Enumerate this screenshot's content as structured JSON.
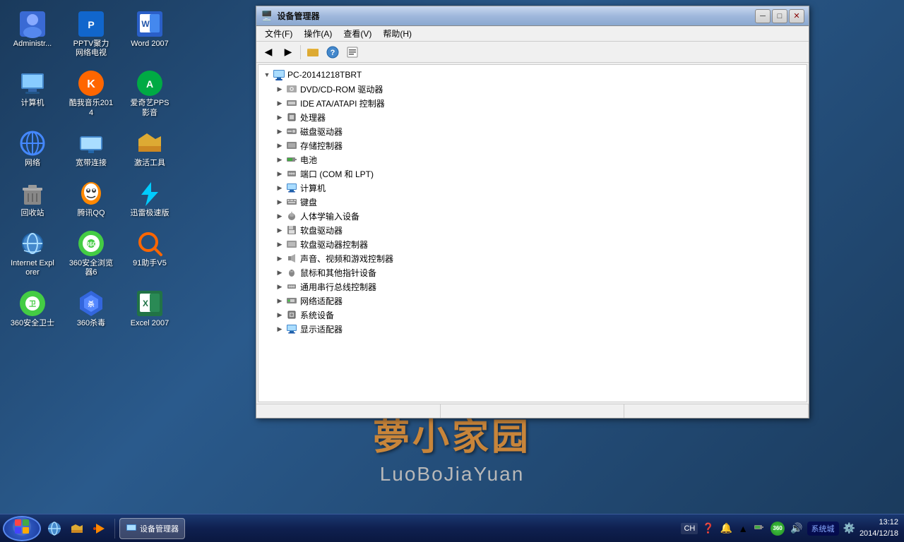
{
  "desktop": {
    "background": "#1a3a5c",
    "watermark": {
      "chinese": "夢小家园",
      "english": "LuoBoJiaYuan"
    },
    "icons": [
      {
        "id": "admin",
        "label": "Administr...",
        "icon": "👤",
        "color": "icon-blue"
      },
      {
        "id": "pptv",
        "label": "PPTV聚力 网络电视",
        "icon": "📺",
        "color": "icon-blue"
      },
      {
        "id": "word2007",
        "label": "Word 2007",
        "icon": "📝",
        "color": "icon-blue"
      },
      {
        "id": "computer",
        "label": "计算机",
        "icon": "🖥️",
        "color": "icon-blue"
      },
      {
        "id": "kuwo",
        "label": "酷我音乐2014",
        "icon": "🎵",
        "color": "icon-orange"
      },
      {
        "id": "aiqiyi",
        "label": "爱奇艺PPS影音",
        "icon": "🎬",
        "color": "icon-orange"
      },
      {
        "id": "network",
        "label": "网络",
        "icon": "🌐",
        "color": "icon-blue"
      },
      {
        "id": "broadband",
        "label": "宽带连接",
        "icon": "💻",
        "color": "icon-blue"
      },
      {
        "id": "activation",
        "label": "激活工具",
        "icon": "📂",
        "color": "icon-yellow"
      },
      {
        "id": "recycle",
        "label": "回收站",
        "icon": "🗑️",
        "color": "icon-gray"
      },
      {
        "id": "qq",
        "label": "腾讯QQ",
        "icon": "🐧",
        "color": "icon-orange"
      },
      {
        "id": "thunder",
        "label": "迅雷极速版",
        "icon": "⚡",
        "color": "icon-cyan"
      },
      {
        "id": "ie",
        "label": "Internet Explorer",
        "icon": "🌐",
        "color": "icon-blue"
      },
      {
        "id": "360browser",
        "label": "360安全浏览器6",
        "icon": "🛡️",
        "color": "icon-green"
      },
      {
        "id": "helper91",
        "label": "91助手V5",
        "icon": "🔍",
        "color": "icon-orange"
      },
      {
        "id": "360guard",
        "label": "360安全卫士",
        "icon": "🛡️",
        "color": "icon-green"
      },
      {
        "id": "360kill",
        "label": "360杀毒",
        "icon": "🛡️",
        "color": "icon-blue"
      },
      {
        "id": "excel2007",
        "label": "Excel 2007",
        "icon": "📊",
        "color": "icon-green"
      }
    ]
  },
  "device_manager": {
    "title": "设备管理器",
    "title_icon": "🖥️",
    "menu": [
      {
        "id": "file",
        "label": "文件(F)"
      },
      {
        "id": "action",
        "label": "操作(A)"
      },
      {
        "id": "view",
        "label": "查看(V)"
      },
      {
        "id": "help",
        "label": "帮助(H)"
      }
    ],
    "computer_name": "PC-20141218TBRT",
    "tree_items": [
      {
        "id": "dvd",
        "label": "DVD/CD-ROM 驱动器",
        "indent": 2,
        "icon": "💿",
        "expandable": true
      },
      {
        "id": "ide",
        "label": "IDE ATA/ATAPI 控制器",
        "indent": 2,
        "icon": "🔌",
        "expandable": true
      },
      {
        "id": "cpu",
        "label": "处理器",
        "indent": 2,
        "icon": "⚙️",
        "expandable": true
      },
      {
        "id": "disk",
        "label": "磁盘驱动器",
        "indent": 2,
        "icon": "💾",
        "expandable": true
      },
      {
        "id": "storage",
        "label": "存储控制器",
        "indent": 2,
        "icon": "🔌",
        "expandable": true
      },
      {
        "id": "battery",
        "label": "电池",
        "indent": 2,
        "icon": "🔋",
        "expandable": true
      },
      {
        "id": "port",
        "label": "端口 (COM 和 LPT)",
        "indent": 2,
        "icon": "🖨️",
        "expandable": true
      },
      {
        "id": "computer_node",
        "label": "计算机",
        "indent": 2,
        "icon": "🖥️",
        "expandable": true
      },
      {
        "id": "keyboard",
        "label": "键盘",
        "indent": 2,
        "icon": "⌨️",
        "expandable": true
      },
      {
        "id": "hid",
        "label": "人体学输入设备",
        "indent": 2,
        "icon": "🖱️",
        "expandable": true
      },
      {
        "id": "floppy",
        "label": "软盘驱动器",
        "indent": 2,
        "icon": "💾",
        "expandable": true
      },
      {
        "id": "floppy_ctrl",
        "label": "软盘驱动器控制器",
        "indent": 2,
        "icon": "🔌",
        "expandable": true
      },
      {
        "id": "sound",
        "label": "声音、视频和游戏控制器",
        "indent": 2,
        "icon": "🔊",
        "expandable": true
      },
      {
        "id": "mouse",
        "label": "鼠标和其他指针设备",
        "indent": 2,
        "icon": "🖱️",
        "expandable": true
      },
      {
        "id": "universal",
        "label": "通用串行总线控制器",
        "indent": 2,
        "icon": "🔌",
        "expandable": true
      },
      {
        "id": "network",
        "label": "网络适配器",
        "indent": 2,
        "icon": "🌐",
        "expandable": true
      },
      {
        "id": "system_dev",
        "label": "系统设备",
        "indent": 2,
        "icon": "⚙️",
        "expandable": true
      },
      {
        "id": "display",
        "label": "显示适配器",
        "indent": 2,
        "icon": "🖥️",
        "expandable": true
      }
    ],
    "toolbar_buttons": [
      {
        "id": "back",
        "label": "←"
      },
      {
        "id": "forward",
        "label": "→"
      },
      {
        "id": "refresh",
        "label": "🗂"
      },
      {
        "id": "help",
        "label": "❓"
      },
      {
        "id": "properties",
        "label": "📋"
      }
    ]
  },
  "taskbar": {
    "start_icon": "⊞",
    "quick_launch": [
      {
        "id": "ie",
        "icon": "🌐"
      },
      {
        "id": "explorer",
        "icon": "📁"
      },
      {
        "id": "media",
        "icon": "▶️"
      }
    ],
    "open_apps": [
      {
        "id": "device_manager",
        "label": "设备管理器",
        "icon": "🖥️",
        "active": true
      }
    ],
    "tray": {
      "lang": "CH",
      "icons": [
        "❓",
        "🔔",
        "▲"
      ],
      "systray_icons": [
        "🔋",
        "🛡️",
        "🔊"
      ],
      "time": "13:12",
      "date": "2014/12/18"
    }
  }
}
